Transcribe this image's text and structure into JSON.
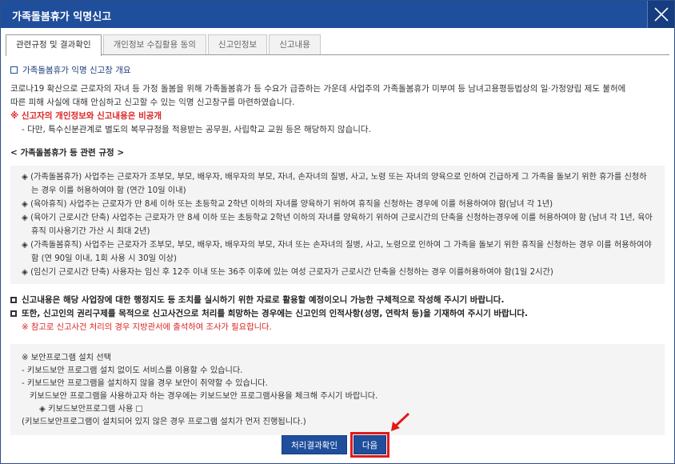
{
  "window": {
    "title": "가족돌봄휴가 익명신고"
  },
  "tabs": [
    {
      "label": "관련규정 및 결과확인"
    },
    {
      "label": "개인정보 수집활용 동의"
    },
    {
      "label": "신고인정보"
    },
    {
      "label": "신고내용"
    }
  ],
  "overview": {
    "heading": "가족돌봄휴가 익명 신고창 개요",
    "paragraph_1": "코로나19 확산으로 근로자의 자녀 등 가정 돌봄을 위해 가족돌봄휴가 등 수요가 급증하는 가운데 사업주의 가족돌봄휴가 미부여 등 남녀고용평등법상의 일·가정양립 제도 불허에",
    "paragraph_2": "따른 피해 사실에 대해 안심하고 신고할 수 있는 익명 신고창구를 마련하였습니다.",
    "private_notice": "※ 신고자의 개인정보와 신고내용은 비공개",
    "exception": "- 다만, 특수신분관계로 별도의 복무규정을 적용받는 공무원, 사립학교 교원 등은 해당하지 않습니다."
  },
  "rules": {
    "title": "< 가족돌봄휴가 등 관련 규정 >",
    "items": [
      "◈ (가족돌봄휴가) 사업주는 근로자가 조부모, 부모, 배우자, 배우자의 부모, 자녀, 손자녀의 질병, 사고, 노령 또는 자녀의 양육으로 인하여 긴급하게 그 가족을 돌보기 위한 휴가를 신청하는 경우 이를 허용하여야 함 (연간 10일 이내)",
      "◈ (육아휴직) 사업주는 근로자가 만 8세 이하 또는 초등학교 2학년 이하의 자녀를 양육하기 위하여 휴직을 신청하는 경우에 이를 허용하여야 함(남녀 각 1년)",
      "◈ (육아기 근로시간 단축) 사업주는 근로자가 만 8세 이하 또는 초등학교 2학년 이하의 자녀를 양육하기 위하여 근로시간의 단축을 신청하는경우에 이를 허용하여야 함 (남녀 각 1년, 육아휴직 미사용기간 가산 시 최대 2년)",
      "◈ (가족돌봄휴직) 사업주는 근로자가 조부모, 부모, 배우자, 배우자의 부모, 자녀 또는 손자녀의 질병, 사고, 노령으로 인하여 그 가족을 돌보기 위한 휴직을 신청하는 경우 이를 허용하여야 함 (연 90일 이내, 1회 사용 시 30일 이상)",
      "◈ (임신기 근로시간 단축) 사용자는 임신 후 12주 이내 또는 36주 이후에 있는 여성 근로자가 근로시간 단축을 신청하는 경우 이를허용하여야 함(1일 2시간)"
    ]
  },
  "notices": {
    "line_1": "신고내용은 해당 사업장에 대한 행정지도 등 조치를 실시하기 위한 자료로 활용할 예정이오니 가능한 구체적으로 작성해 주시기 바랍니다.",
    "line_2": "또한, 신고인의 권리구제를 목적으로 신고사건으로 처리를 희망하는 경우에는 신고인의 인적사항(성명, 연락처 등)을 기재하여 주시기 바랍니다.",
    "red_note": "※ 참고로 신고사건 처리의 경우 지방관서에 출석하여 조사가 필요합니다."
  },
  "security": {
    "heading": "※ 보안프로그램 설치 선택",
    "line_1": "- 키보드보안 프로그램 설치 없이도 서비스를 이용할 수 있습니다.",
    "line_2": "- 키보드보안 프로그램을 설치하지 않을 경우 보안이 취약할 수 있습니다.",
    "line_3": "키보드보안 프로그램을 사용하고자 하는 경우에는 키보드보안 프로그램사용을 체크해 주시기 바랍니다.",
    "checkbox_label": "◈ 키보드보안프로그램  사용",
    "line_4": "(키보드보안프로그램이 설치되어 있지 않은 경우 프로그램 설치가 먼저 진행됩니다.)"
  },
  "buttons": {
    "result_label": "처리결과확인",
    "next_label": "다음"
  },
  "colors": {
    "title_bar": "#1f4e9c",
    "button": "#1f4e9c",
    "highlight": "#e21a1a",
    "alert_text": "#dd2222"
  }
}
